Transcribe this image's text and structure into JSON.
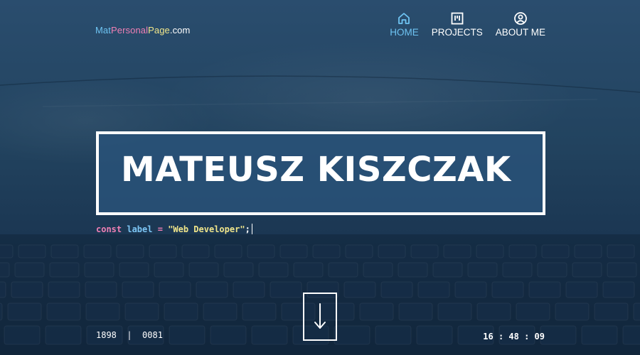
{
  "header": {
    "logo_parts": [
      "Mat",
      "Personal",
      "Page",
      ".com"
    ],
    "nav": [
      {
        "label": "HOME",
        "icon": "home-icon",
        "active": true
      },
      {
        "label": "PROJECTS",
        "icon": "kanban-icon",
        "active": false
      },
      {
        "label": "ABOUT ME",
        "icon": "user-circle-icon",
        "active": false
      }
    ]
  },
  "hero": {
    "title": "MATEUSZ KISZCZAK",
    "code": {
      "keyword": "const",
      "variable": "label",
      "operator": "=",
      "string": "\"Web Developer\"",
      "end": ";"
    }
  },
  "scroll": {
    "icon": "arrow-down-icon"
  },
  "footer": {
    "coords": "1898  |  0081",
    "clock": "16 : 48 : 09"
  },
  "colors": {
    "accent": "#6ec3f2",
    "pink": "#ef7fb4",
    "yellow": "#f0e58a",
    "box_fill": "#29537a"
  }
}
